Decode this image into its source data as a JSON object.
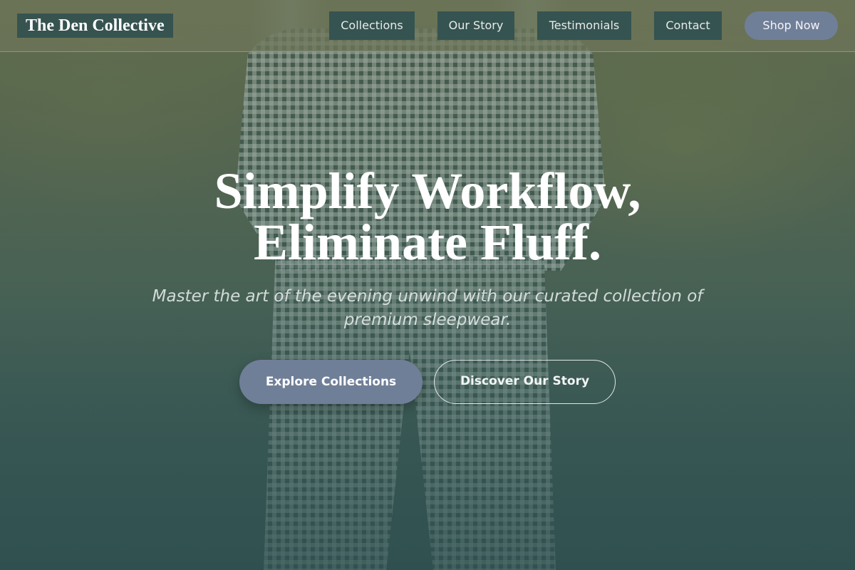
{
  "header": {
    "logo": "The Den Collective",
    "nav": [
      {
        "label": "Collections"
      },
      {
        "label": "Our Story"
      },
      {
        "label": "Testimonials"
      },
      {
        "label": "Contact"
      }
    ],
    "cta_label": "Shop Now"
  },
  "hero": {
    "title_line1": "Simplify Workflow,",
    "title_line2": "Eliminate Fluff.",
    "subtitle": "Master the art of the evening unwind with our curated collection of premium sleepwear.",
    "primary_button": "Explore Collections",
    "secondary_button": "Discover Our Story"
  },
  "colors": {
    "nav_background": "#355350",
    "accent_button": "#707f98",
    "header_background": "#6e765a",
    "text_light": "#ffffff"
  }
}
